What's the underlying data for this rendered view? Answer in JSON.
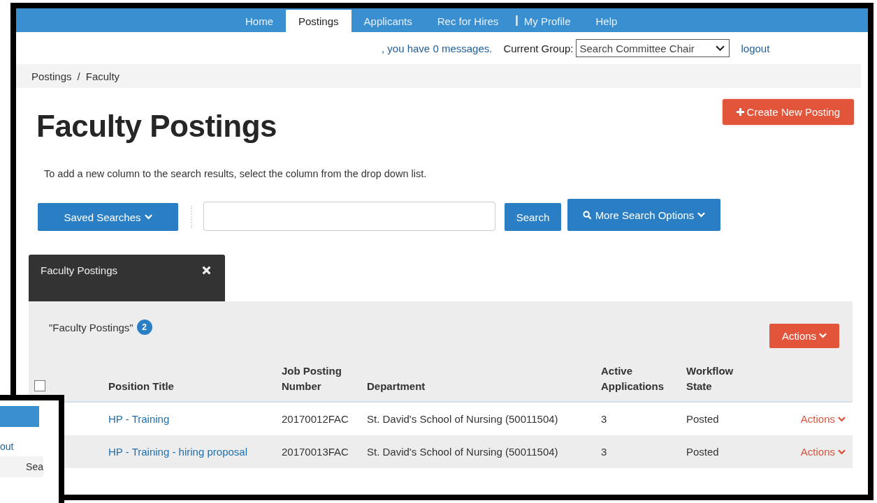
{
  "nav": {
    "items": [
      {
        "kind": "tab",
        "label": "Home",
        "selected": false
      },
      {
        "kind": "tab",
        "label": "Postings",
        "selected": true
      },
      {
        "kind": "tab",
        "label": "Applicants",
        "selected": false
      },
      {
        "kind": "tab",
        "label": "Rec for Hires",
        "selected": false
      },
      {
        "kind": "separator",
        "label": "|"
      },
      {
        "kind": "tab",
        "label": "My Profile",
        "selected": false
      },
      {
        "kind": "tab",
        "label": "Help",
        "selected": false
      }
    ]
  },
  "user_bar": {
    "message": ", you have 0 messages.",
    "group_label": "Current Group:",
    "group_value": "Search Committee Chair",
    "logout": "logout"
  },
  "breadcrumb": {
    "items": [
      "Postings",
      "Faculty"
    ],
    "separator": "/"
  },
  "page_title": "Faculty Postings",
  "create_button": "Create New Posting",
  "hint": "To add a new column to the search results, select the column from the drop down list.",
  "saved_searches": "Saved Searches",
  "search_button": "Search",
  "more_options": "More Search Options",
  "tab": {
    "label": "Faculty Postings"
  },
  "results": {
    "title": "\"Faculty Postings\"",
    "count": "2",
    "actions": "Actions",
    "select_all_checked": false,
    "columns": [
      "Position Title",
      "Job Posting Number",
      "Department",
      "Active Applications",
      "Workflow State"
    ],
    "rows": [
      {
        "title": "HP - Training",
        "number": "20170012FAC",
        "department": "St. David's School of Nursing (50011504)",
        "applications": "3",
        "state": "Posted",
        "action": "Actions"
      },
      {
        "title": "HP - Training - hiring proposal",
        "number": "20170013FAC",
        "department": "St. David's School of Nursing (50011504)",
        "applications": "3",
        "state": "Posted",
        "action": "Actions"
      }
    ]
  },
  "inset": {
    "texts": [
      "out",
      "Sea"
    ]
  }
}
